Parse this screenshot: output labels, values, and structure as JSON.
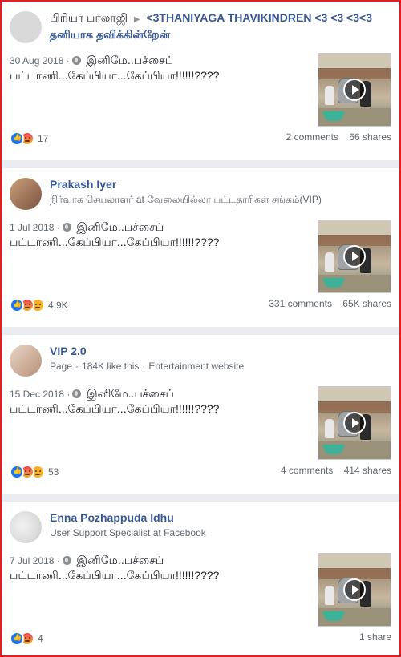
{
  "posts": [
    {
      "author": "பிரியா பாலாஜி",
      "target": "<3THANIYAGA THAVIKINDREN <3 <3 <3<3 தனியாக தவிக்கின்றேன்",
      "subtitle": "",
      "date": "30 Aug 2018",
      "text": "இனிமே..பச்சைப் பட்டாணி...கேப்பியா...கேப்பியா!!!!!!????",
      "reaction_count": "17",
      "reactions": [
        "like-icon",
        "angry-icon"
      ],
      "comments": "2 comments",
      "shares": "66 shares"
    },
    {
      "author": "Prakash Iyer",
      "target": "",
      "subtitle": "நிர்வாக செயலாளர் at வேலையில்லா பட்டதாரிகள் சங்கம்(VIP)",
      "date": "1 Jul 2018",
      "text": "இனிமே..பச்சைப் பட்டாணி...கேப்பியா...கேப்பியா!!!!!!????",
      "reaction_count": "4.9K",
      "reactions": [
        "like-icon",
        "angry-icon",
        "sad-icon"
      ],
      "comments": "331 comments",
      "shares": "65K shares"
    },
    {
      "author": "VIP 2.0",
      "target": "",
      "subtitle_parts": [
        "Page",
        "184K like this",
        "Entertainment website"
      ],
      "date": "15 Dec 2018",
      "text": "இனிமே..பச்சைப் பட்டாணி...கேப்பியா...கேப்பியா!!!!!!????",
      "reaction_count": "53",
      "reactions": [
        "like-icon",
        "angry-icon",
        "haha-icon"
      ],
      "comments": "4 comments",
      "shares": "414 shares"
    },
    {
      "author": "Enna Pozhappuda Idhu",
      "target": "",
      "subtitle": "User Support Specialist at Facebook",
      "date": "7 Jul 2018",
      "text": "இனிமே..பச்சைப் பட்டாணி...கேப்பியா...கேப்பியா!!!!!!????",
      "reaction_count": "4",
      "reactions": [
        "like-icon",
        "angry-icon"
      ],
      "comments": "",
      "shares": "1 share"
    }
  ],
  "colors": {
    "link": "#385898",
    "like": "#1877f2",
    "frame": "#e02020"
  }
}
